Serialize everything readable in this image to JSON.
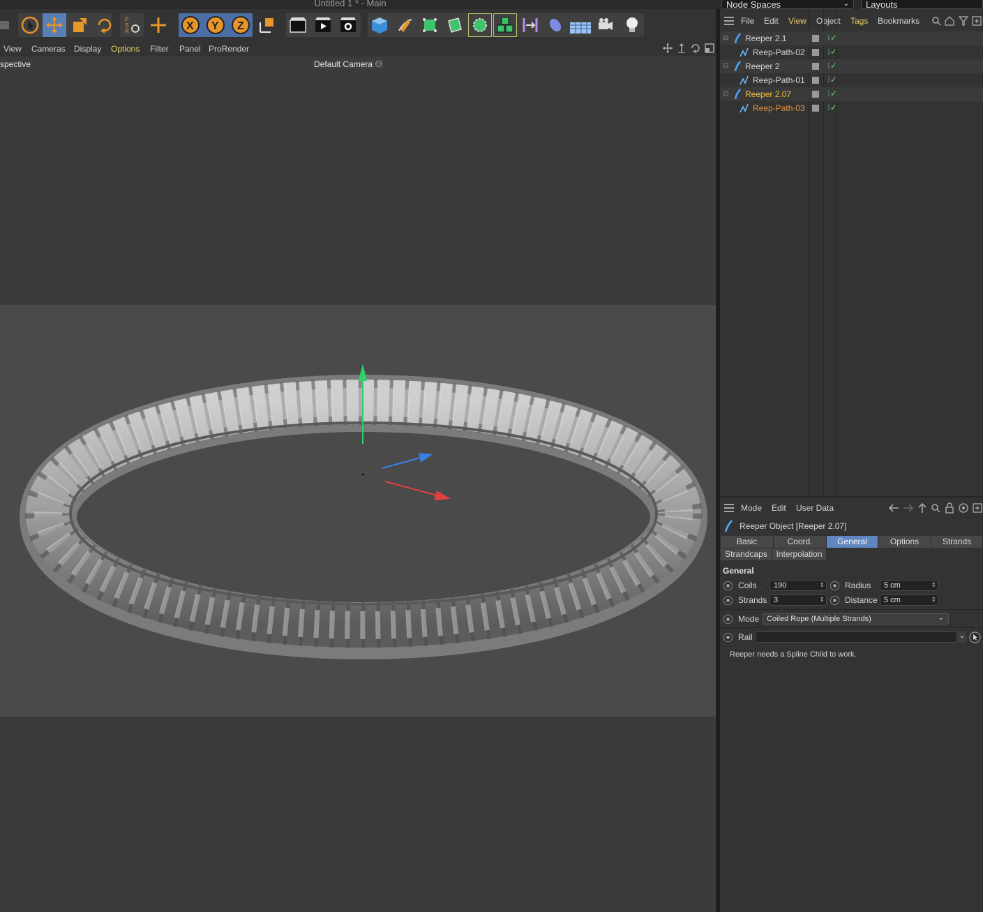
{
  "window": {
    "title": "Untitled 1 * - Main",
    "node_spaces": "Node Spaces",
    "layouts": "Layouts"
  },
  "viewport": {
    "menu": [
      "View",
      "Cameras",
      "Display",
      "Options",
      "Filter",
      "Panel",
      "ProRender"
    ],
    "active_menu": "Options",
    "label": "spective",
    "camera": "Default Camera"
  },
  "toolbar": {
    "icons": [
      "live-selection-icon",
      "move-icon",
      "scale-icon",
      "rotate-icon",
      "psr-icon",
      "transform-icon",
      "x-axis-icon",
      "y-axis-icon",
      "z-axis-icon",
      "coordinate-system-icon",
      "render-view-icon",
      "render-picture-viewer-icon",
      "render-settings-icon",
      "cube-icon",
      "pen-icon",
      "subdivision-icon",
      "extrude-icon",
      "cloner-icon",
      "mograph-icon",
      "deformer-icon",
      "field-icon",
      "floor-icon",
      "camera-icon",
      "light-icon"
    ]
  },
  "object_manager": {
    "menu": [
      "File",
      "Edit",
      "View",
      "Object",
      "Tags",
      "Bookmarks"
    ],
    "objects": [
      {
        "name": "Reeper 2.1",
        "level": 0,
        "type": "reeper"
      },
      {
        "name": "Reep-Path-02",
        "level": 1,
        "type": "spline"
      },
      {
        "name": "Reeper 2",
        "level": 0,
        "type": "reeper"
      },
      {
        "name": "Reep-Path-01",
        "level": 1,
        "type": "spline"
      },
      {
        "name": "Reeper 2.07",
        "level": 0,
        "type": "reeper",
        "state": "selected"
      },
      {
        "name": "Reep-Path-03",
        "level": 1,
        "type": "spline",
        "state": "child-selected"
      }
    ]
  },
  "attribute_manager": {
    "menu": [
      "Mode",
      "Edit",
      "User Data"
    ],
    "object_title": "Reeper Object [Reeper 2.07]",
    "tabs_row1": [
      "Basic",
      "Coord.",
      "General",
      "Options",
      "Strands"
    ],
    "tabs_row2": [
      "Strandcaps",
      "Interpolation"
    ],
    "active_tab": "General",
    "section": "General",
    "coils_label": "Coils",
    "coils": "190",
    "radius_label": "Radius",
    "radius": "5 cm",
    "strands_label": "Strands",
    "strands": "3",
    "distance_label": "Distance",
    "distance": "5 cm",
    "mode_label": "Mode",
    "mode": "Coiled Rope (Multiple Strands)",
    "rail_label": "Rail",
    "rail": "",
    "message": "Reeper needs a Spline Child to work."
  },
  "colors": {
    "accent_blue": "#5f86c0",
    "accent_yellow": "#e8d06a",
    "selected_orange": "#f0c040",
    "check_green": "#6dd070"
  }
}
